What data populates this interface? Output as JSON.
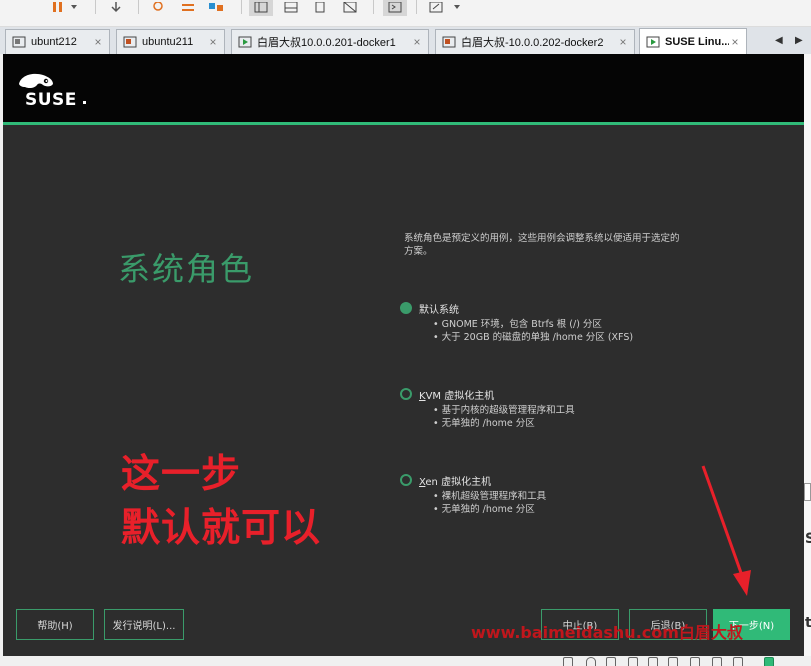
{
  "tabs": [
    {
      "label": "ubunt212",
      "active": false
    },
    {
      "label": "ubuntu211",
      "active": false
    },
    {
      "label": "白眉大叔10.0.0.201-docker1",
      "active": false
    },
    {
      "label": "白眉大叔-10.0.0.202-docker2",
      "active": false
    },
    {
      "label": "SUSE Linu...",
      "active": true
    }
  ],
  "tab_close_glyph": "×",
  "tab_nav": {
    "prev": "◀",
    "next": "▶"
  },
  "vm": {
    "brand": "SUSE",
    "page_title": "系统角色",
    "description": "系统角色是预定义的用例，这些用例会调整系统以便适用于选定的方案。",
    "roles": [
      {
        "name_mnemonic": "",
        "name_rest": "默认系统",
        "checked": true,
        "bullets": [
          "• GNOME 环境，包含 Btrfs 根 (/) 分区",
          "• 大于 20GB 的磁盘的单独 /home 分区 (XFS)"
        ]
      },
      {
        "name_mnemonic": "K",
        "name_rest": "VM 虚拟化主机",
        "checked": false,
        "bullets": [
          "• 基于内核的超级管理程序和工具",
          "• 无单独的 /home 分区"
        ]
      },
      {
        "name_mnemonic": "X",
        "name_rest": "en 虚拟化主机",
        "checked": false,
        "bullets": [
          "• 裸机超级管理程序和工具",
          "• 无单独的 /home 分区"
        ]
      }
    ],
    "buttons": {
      "help": "帮助(H)",
      "release_notes": "发行说明(L)...",
      "abort": "中止(B)",
      "back": "后退(B)",
      "next": "下一步(N)"
    }
  },
  "annotation": {
    "line1": "这一步",
    "line2": "默认就可以"
  },
  "watermark": "www.baimeidashu.com白眉大叔",
  "colors": {
    "suse_green": "#30ba78",
    "annotation_red": "#e8202a"
  }
}
